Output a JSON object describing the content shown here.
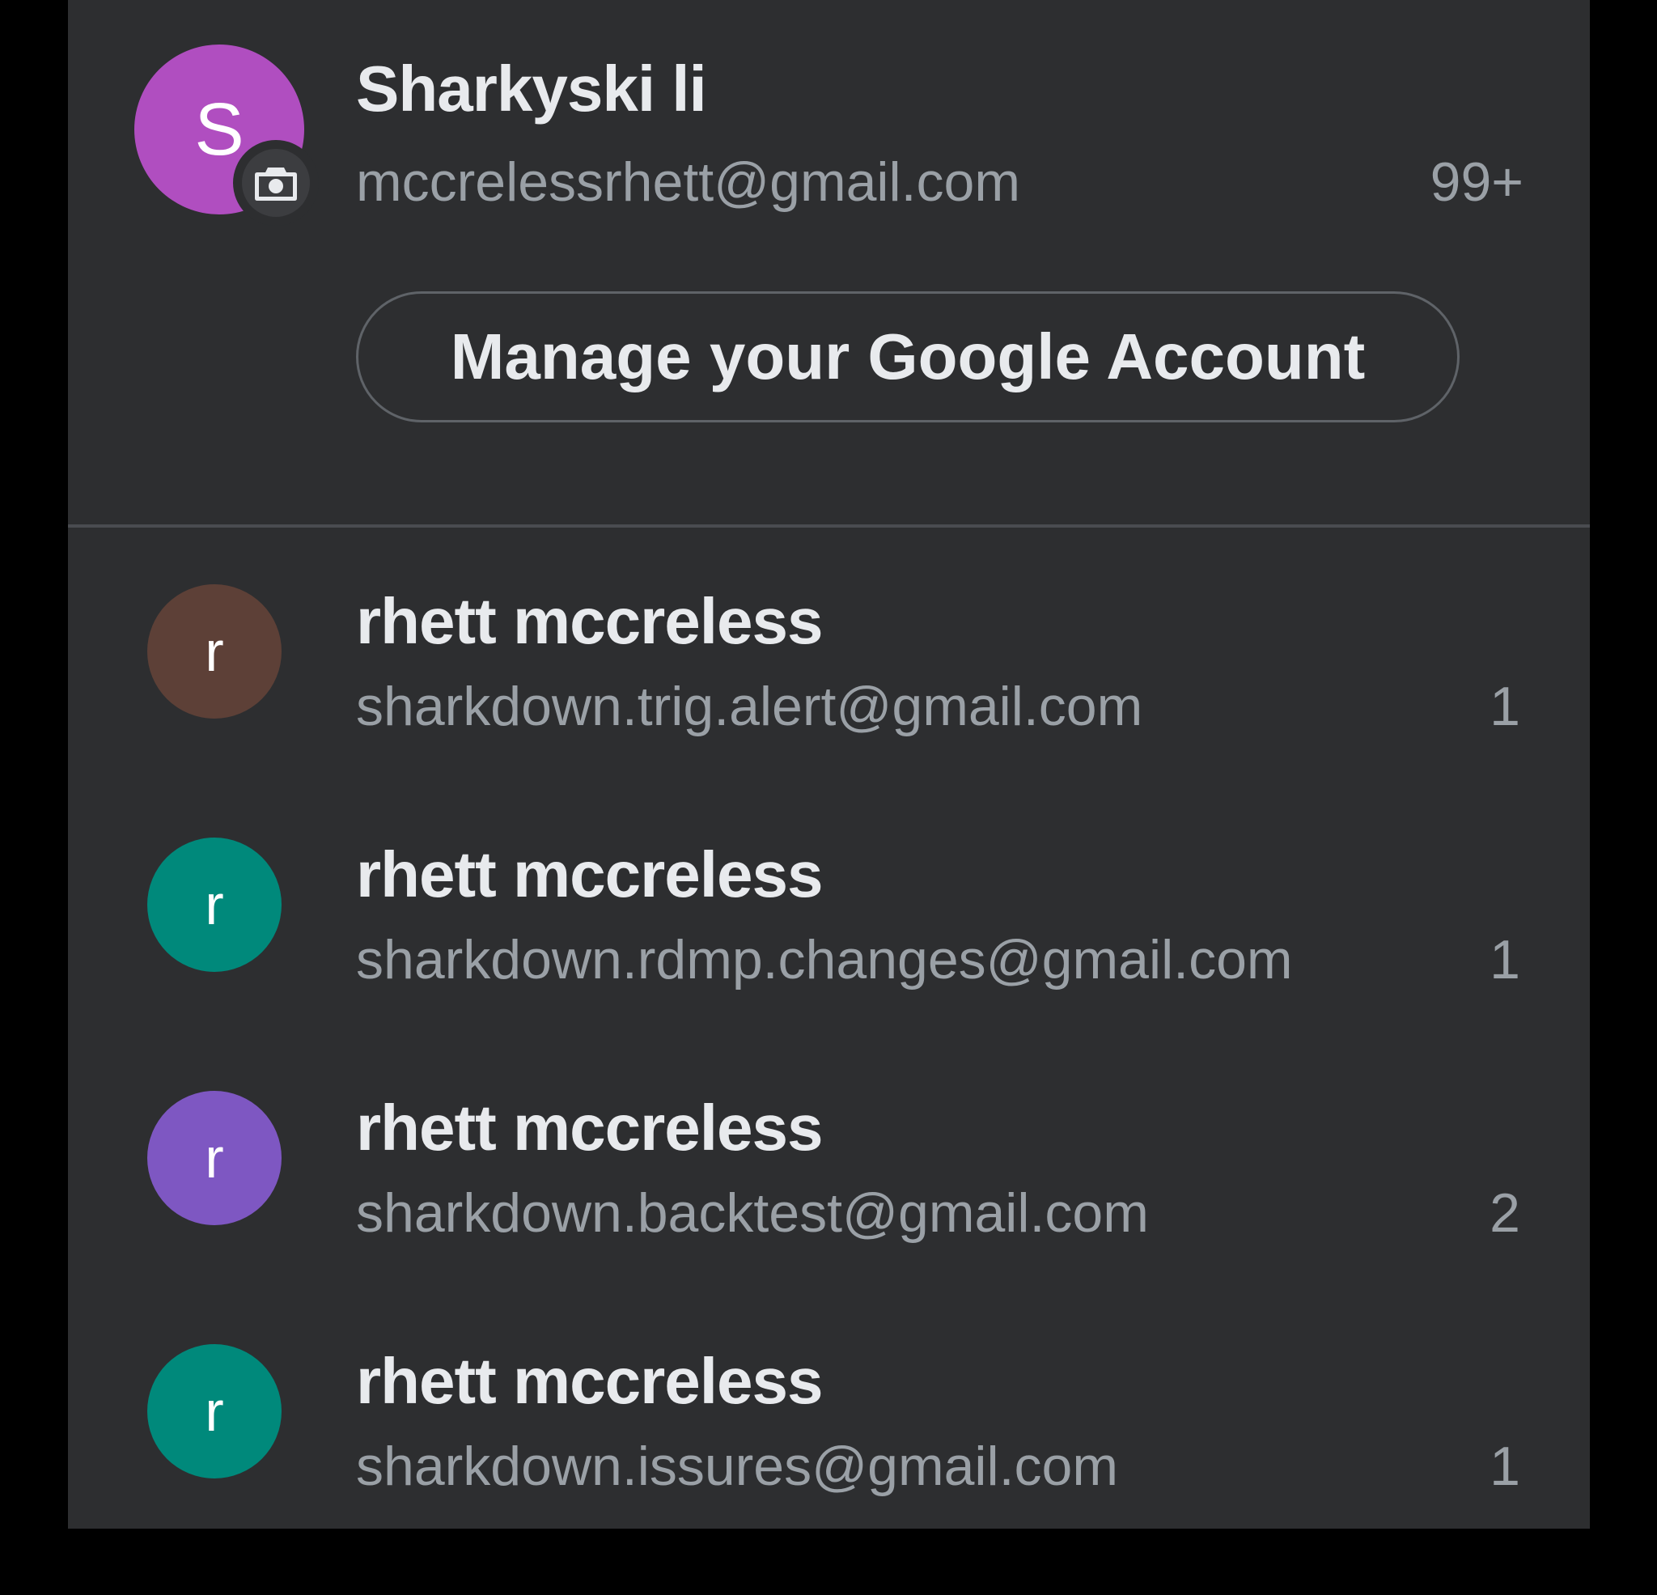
{
  "primary_account": {
    "name": "Sharkyski li",
    "email": "mccrelessrhett@gmail.com",
    "unread_count": "99+",
    "avatar_initial": "S",
    "avatar_color": "#b04ec0",
    "badge_icon": "camera-icon"
  },
  "manage_button_label": "Manage your Google Account",
  "accounts": [
    {
      "name": "rhett mccreless",
      "email": "sharkdown.trig.alert@gmail.com",
      "unread_count": "1",
      "avatar_initial": "r",
      "avatar_color": "#5d4037"
    },
    {
      "name": "rhett mccreless",
      "email": "sharkdown.rdmp.changes@gmail.com",
      "unread_count": "1",
      "avatar_initial": "r",
      "avatar_color": "#00897b"
    },
    {
      "name": "rhett mccreless",
      "email": "sharkdown.backtest@gmail.com",
      "unread_count": "2",
      "avatar_initial": "r",
      "avatar_color": "#7e57c2"
    },
    {
      "name": "rhett mccreless",
      "email": "sharkdown.issures@gmail.com",
      "unread_count": "1",
      "avatar_initial": "r",
      "avatar_color": "#00897b"
    }
  ]
}
